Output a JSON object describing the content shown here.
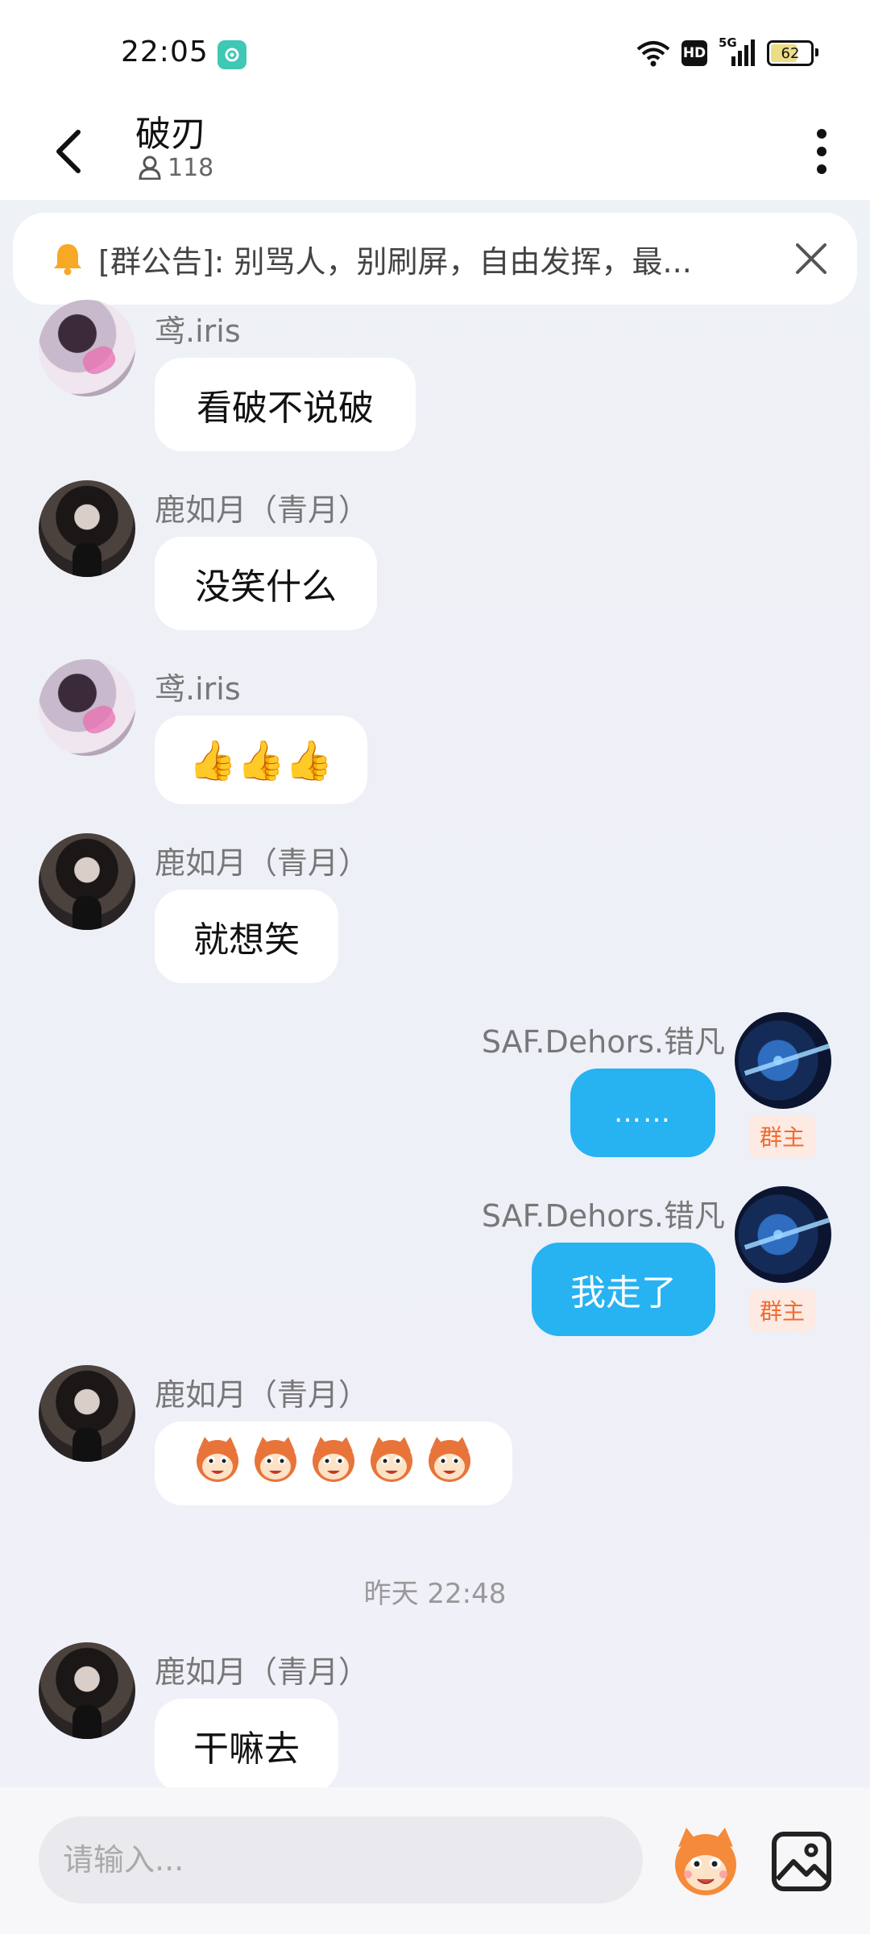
{
  "status_bar": {
    "time": "22:05",
    "network": "5G",
    "hd": "HD",
    "battery": "62"
  },
  "header": {
    "title": "破刃",
    "member_count": "118"
  },
  "notice": {
    "text": "[群公告]: 别骂人，别刷屏，自由发挥，最..."
  },
  "messages": [
    {
      "sender": "鸢.iris",
      "text": "看破不说破"
    },
    {
      "sender": "鹿如月（青月）",
      "text": "没笑什么"
    },
    {
      "sender": "鸢.iris",
      "text": "👍👍👍"
    },
    {
      "sender": "鹿如月（青月）",
      "text": "就想笑"
    },
    {
      "sender": "SAF.Dehors.错凡",
      "text": "……",
      "badge": "群主"
    },
    {
      "sender": "SAF.Dehors.错凡",
      "text": "我走了",
      "badge": "群主"
    },
    {
      "sender": "鹿如月（青月）",
      "text": "",
      "sticker_count": 5
    },
    {
      "sender": "鹿如月（青月）",
      "text": "干嘛去"
    }
  ],
  "timestamp": "昨天 22:48",
  "input": {
    "placeholder": "请输入..."
  },
  "icons": {
    "back": "back-chevron-icon",
    "more": "more-vertical-icon",
    "bell": "bell-icon",
    "close": "close-icon",
    "person": "person-icon",
    "emoji": "emoji-sticker-icon",
    "image": "image-icon"
  },
  "colors": {
    "self_bubble": "#27b2f2",
    "owner_badge_text": "#f26b2f",
    "owner_badge_bg": "#fdeae2"
  }
}
